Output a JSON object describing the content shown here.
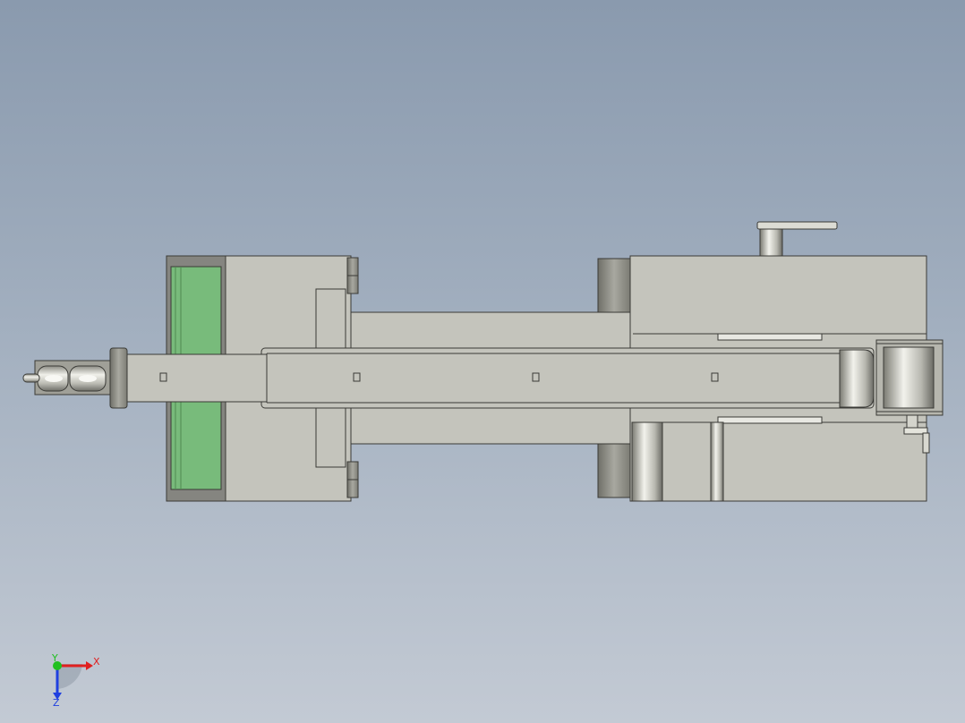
{
  "viewport": {
    "background_top": "#8a9aae",
    "background_bottom": "#c3cad4"
  },
  "model": {
    "body_color": "#c4c4bc",
    "edge_color": "#3a3a36",
    "accent_color": "#78bb7b",
    "parts": [
      "sheave-assembly",
      "end-flange",
      "rear-block",
      "cylinder-window",
      "boom-body",
      "telescoping-beam",
      "pivot-housing",
      "drive-motor",
      "crank-handle",
      "pulley",
      "bolt-heads"
    ]
  },
  "triad": {
    "x_label": "X",
    "y_label": "Y",
    "z_label": "Z",
    "x_color": "#e02020",
    "y_color": "#20c020",
    "z_color": "#2040e0"
  }
}
